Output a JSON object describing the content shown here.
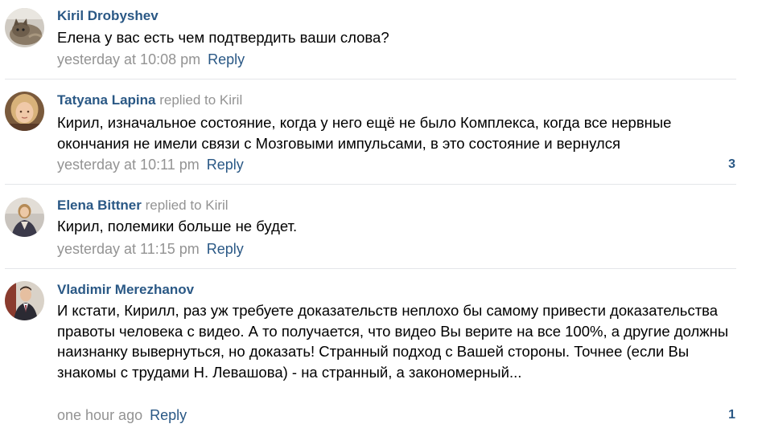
{
  "comments": [
    {
      "author": "Kiril Drobyshev",
      "replied": "",
      "text": "Елена у вас есть чем подтвердить ваши слова?",
      "time": "yesterday at 10:08 pm",
      "reply_label": "Reply",
      "likes": "",
      "avatar_icon": "cat-photo-icon"
    },
    {
      "author": "Tatyana Lapina",
      "replied": "replied to Kiril",
      "text": "Кирил, изначальное состояние, когда у него ещё не было Комплекса, когда все нервные окончания не имели связи с Мозговыми импульсами, в это состояние и вернулся",
      "time": "yesterday at 10:11 pm",
      "reply_label": "Reply",
      "likes": "3",
      "avatar_icon": "woman-portrait-icon"
    },
    {
      "author": "Elena Bittner",
      "replied": "replied to Kiril",
      "text": "Кирил, полемики больше не будет.",
      "time": "yesterday at 11:15 pm",
      "reply_label": "Reply",
      "likes": "",
      "avatar_icon": "woman-seated-portrait-icon"
    },
    {
      "author": "Vladimir Merezhanov",
      "replied": "",
      "text": "И кстати, Кирилл, раз уж требуете доказательств неплохо бы самому привести доказательства правоты человека с видео. А то получается, что видео Вы верите на все 100%, а другие должны наизнанку вывернуться, но доказать! Странный подход с Вашей стороны. Точнее (если Вы знакомы с трудами Н. Левашова) - на странный, а закономерный...",
      "time": "one hour ago",
      "reply_label": "Reply",
      "likes": "1",
      "avatar_icon": "man-in-suit-icon"
    }
  ],
  "colors": {
    "link": "#2a5885",
    "muted": "#939393",
    "divider": "#e4e6e9"
  }
}
